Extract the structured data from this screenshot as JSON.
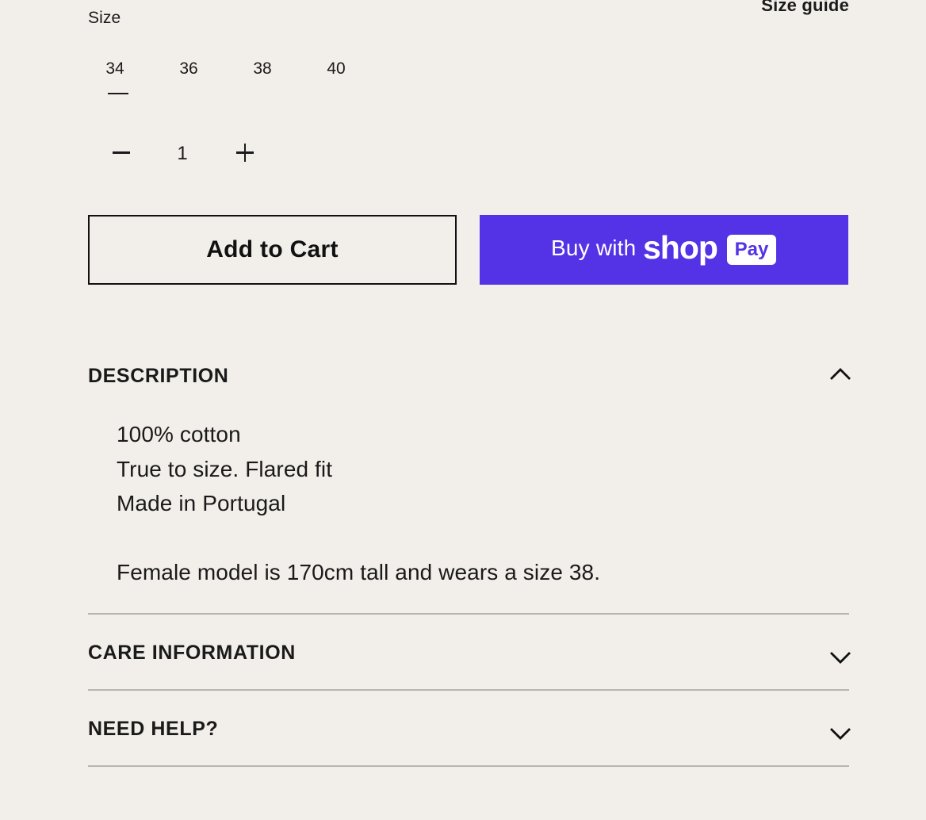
{
  "size": {
    "label": "Size",
    "guide_link": "Size guide",
    "options": [
      "34",
      "36",
      "38",
      "40"
    ],
    "selected": "34"
  },
  "quantity": {
    "value": "1",
    "decrease_icon": "minus-icon",
    "increase_icon": "plus-icon"
  },
  "actions": {
    "add_to_cart": "Add to Cart",
    "buy_with": "Buy with",
    "shop_brand": "shop",
    "pay_badge": "Pay",
    "shop_pay_color": "#5433e6"
  },
  "accordions": {
    "description": {
      "title": "DESCRIPTION",
      "expanded": true,
      "lines": [
        "100% cotton",
        "True to size. Flared fit",
        "Made in Portugal"
      ],
      "note": "Female model is 170cm tall and wears a size 38."
    },
    "care": {
      "title": "CARE INFORMATION",
      "expanded": false
    },
    "help": {
      "title": "NEED HELP?",
      "expanded": false
    }
  },
  "colors": {
    "background": "#f2eeea",
    "text": "#1a1a1a",
    "divider": "#b8b4b0"
  }
}
